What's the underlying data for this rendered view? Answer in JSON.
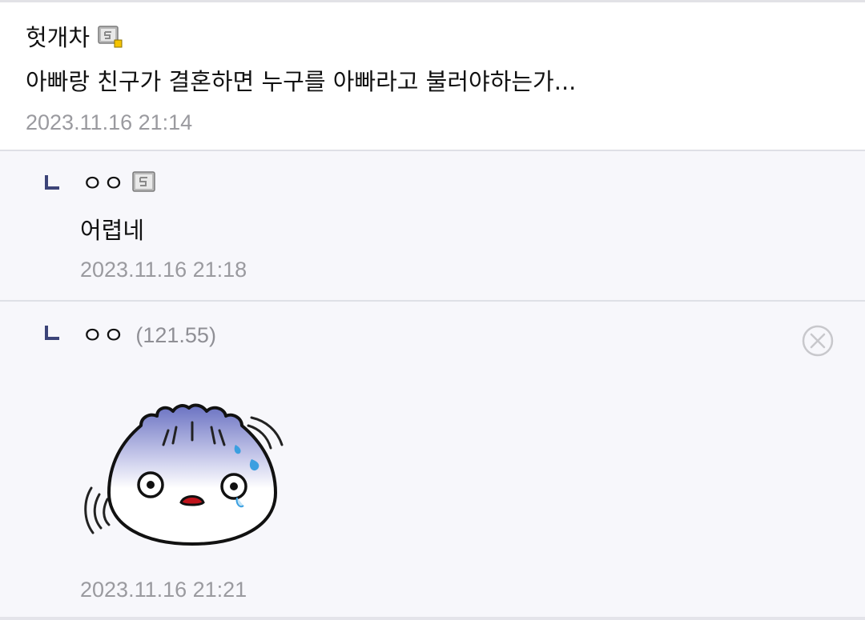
{
  "comments": [
    {
      "nickname": "헛개차",
      "user_icon": "fixed-nick-badge-icon",
      "text": "아빠랑 친구가 결혼하면 누구를 아빠라고 불러야하는가...",
      "date": "2023.11.16 21:14"
    }
  ],
  "replies": [
    {
      "reply_marker": "ㄴ",
      "nickname": "ㅇㅇ",
      "user_icon": "semi-fixed-nick-badge-icon",
      "text": "어렵네",
      "date": "2023.11.16 21:18"
    },
    {
      "reply_marker": "ㄴ",
      "nickname": "ㅇㅇ",
      "ip": "(121.55)",
      "delete_icon": "close-circle-icon",
      "sticker": "dumpling-sweating-sticker",
      "date": "2023.11.16 21:21"
    }
  ],
  "colors": {
    "reply_background": "#f7f7fb",
    "reply_marker": "#3c4478",
    "date_text": "#9a9a9f",
    "separator": "#dfe0e6"
  }
}
